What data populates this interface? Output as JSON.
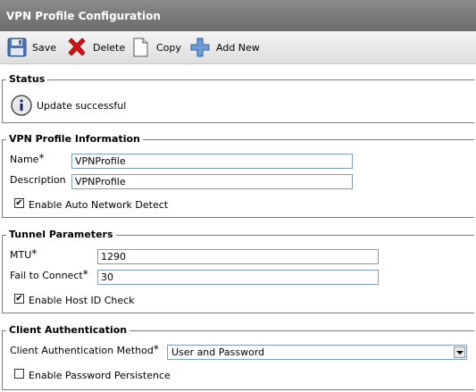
{
  "window": {
    "title": "VPN Profile Configuration"
  },
  "toolbar": {
    "save_label": "Save",
    "delete_label": "Delete",
    "copy_label": "Copy",
    "add_new_label": "Add New"
  },
  "status": {
    "legend": "Status",
    "message": "Update successful"
  },
  "profile_info": {
    "legend": "VPN Profile Information",
    "name_label": "Name",
    "name_value": "VPNProfile",
    "description_label": "Description",
    "description_value": "VPNProfile",
    "auto_detect_label": "Enable Auto Network Detect",
    "auto_detect_checked": true
  },
  "tunnel": {
    "legend": "Tunnel Parameters",
    "mtu_label": "MTU",
    "mtu_value": "1290",
    "fail_label": "Fail to Connect",
    "fail_value": "30",
    "host_id_label": "Enable Host ID Check",
    "host_id_checked": true
  },
  "client_auth": {
    "legend": "Client Authentication",
    "method_label": "Client Authentication Method",
    "method_value": "User and Password",
    "persist_label": "Enable Password Persistence",
    "persist_checked": false
  },
  "required_marker": "*"
}
